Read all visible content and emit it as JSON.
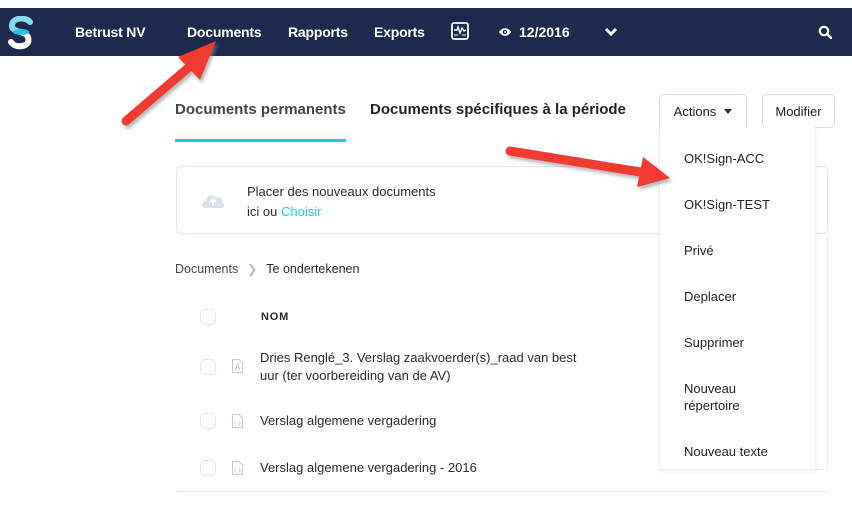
{
  "topbar": {
    "logo": "S",
    "company": "Betrust NV",
    "nav": [
      "Documents",
      "Rapports",
      "Exports"
    ],
    "icons": {
      "monitor": "monitor-chart-icon",
      "eye": "eye-icon",
      "chevron": "chevron-down-icon",
      "search": "search-icon"
    },
    "period": "12/2016"
  },
  "tabs": [
    {
      "label": "Documents permanents",
      "active": true
    },
    {
      "label": "Documents spécifiques à la période",
      "active": false
    }
  ],
  "buttons": {
    "actions": "Actions",
    "modifier": "Modifier"
  },
  "upload": {
    "line1": "Placer des nouveaux documents",
    "line2_prefix": "ici ou ",
    "link": "Choisir"
  },
  "breadcrumb": {
    "root": "Documents",
    "current": "Te ondertekenen"
  },
  "table": {
    "header": "NOM",
    "rows": [
      {
        "line1": "Dries Renglé_3. Verslag zaakvoerder(s)_raad van best",
        "line2": "uur (ter voorbereiding van de AV)",
        "type": "pdf"
      },
      {
        "line1": "Verslag algemene vergadering",
        "type": "code"
      },
      {
        "line1": "Verslag algemene vergadering - 2016",
        "type": "code"
      }
    ]
  },
  "actions_menu": [
    "OK!Sign-ACC",
    "OK!Sign-TEST",
    "Privé",
    "Deplacer",
    "Supprimer",
    "Nouveau répertoire",
    "Nouveau texte"
  ],
  "colors": {
    "navbar": "#1d2a4e",
    "accent": "#1ec8e6",
    "annotation_arrow": "#f03a32"
  }
}
